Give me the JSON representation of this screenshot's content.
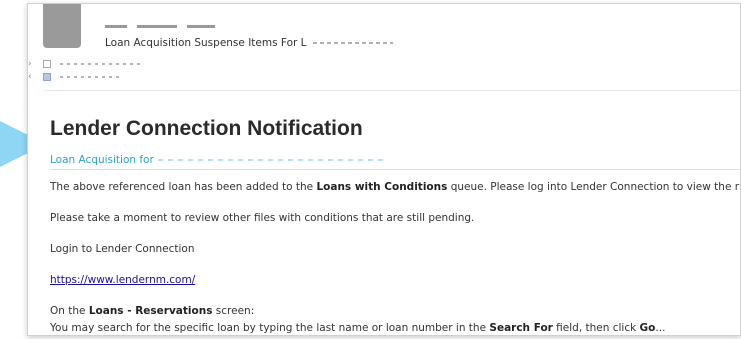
{
  "email": {
    "subject": "Loan Acquisition Suspense Items For L",
    "notification_title": "Lender Connection Notification",
    "subtitle": "Loan Acquisition for",
    "paragraph1": {
      "prefix": "The above referenced loan has been added to the ",
      "bold": "Loans with Conditions",
      "suffix": " queue. Please log into Lender Connection to view the r"
    },
    "paragraph2": "Please take a moment to review other files with conditions that are still pending.",
    "paragraph3": "Login to Lender Connection",
    "link": "https://www.lendernm.com/",
    "paragraph5": {
      "prefix": "On the ",
      "bold": "Loans - Reservations",
      "suffix": " screen:"
    },
    "paragraph6": {
      "prefix": "You may search for the specific loan by typing the last name or loan number in the ",
      "bold1": "Search For",
      "middle": " field, then click ",
      "bold2": "Go",
      "suffix": "..."
    }
  },
  "colors": {
    "arrow": "#8fd6f5",
    "subtitle": "#2aa3c9",
    "link": "#1a0dab"
  }
}
